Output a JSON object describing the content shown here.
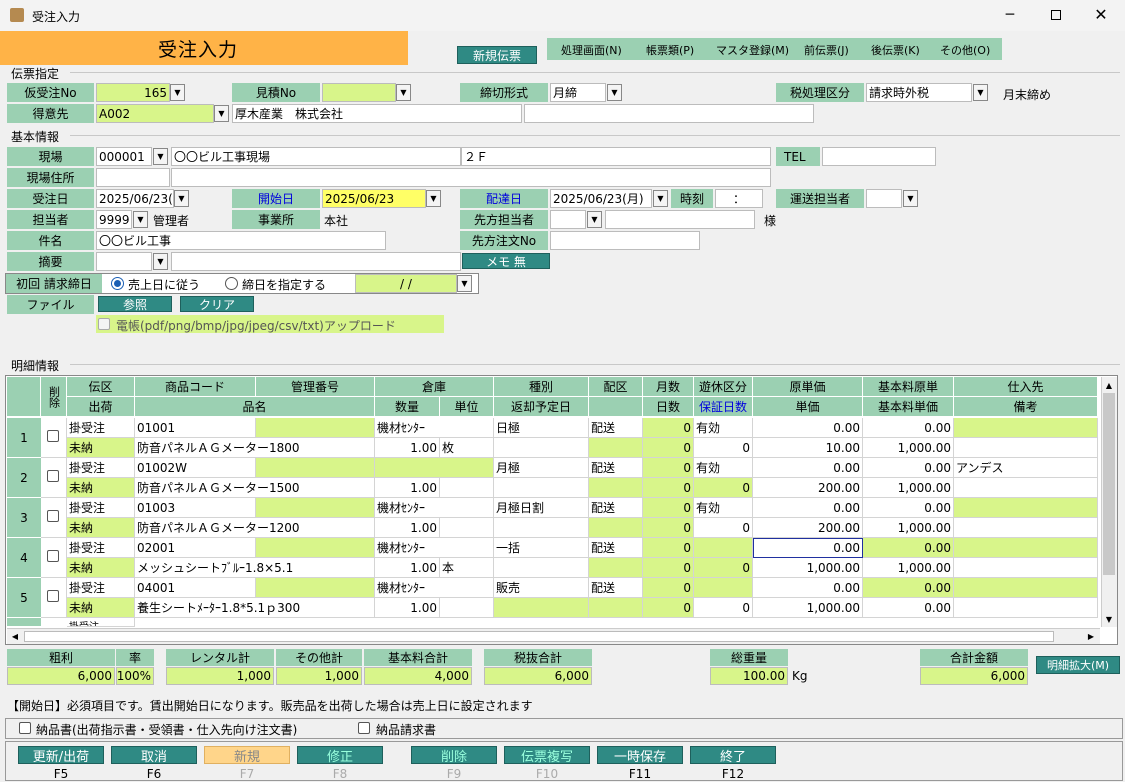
{
  "window": {
    "title": "受注入力"
  },
  "header": {
    "title": "受注入力",
    "new_button": "新規伝票",
    "menu": [
      "処理画面(N)",
      "帳票類(P)",
      "マスタ登録(M)",
      "前伝票(J)",
      "後伝票(K)",
      "その他(O)"
    ]
  },
  "denpyo": {
    "section": "伝票指定",
    "kari_label": "仮受注No",
    "kari_value": "165",
    "mitsumori_label": "見積No",
    "mitsumori_value": "",
    "shime_label": "締切形式",
    "shime_value": "月締",
    "zei_label": "税処理区分",
    "zei_value": "請求時外税",
    "gatsumatsu": "月末締め",
    "tokui_label": "得意先",
    "tokui_code": "A002",
    "tokui_name": "厚木産業　株式会社"
  },
  "kihon": {
    "section": "基本情報",
    "genba_label": "現場",
    "genba_code": "000001",
    "genba_name": "〇〇ビル工事現場",
    "genba_floor": "２Ｆ",
    "tel_label": "TEL",
    "tel_value": "",
    "jusho_label": "現場住所",
    "juchu_label": "受注日",
    "juchu_value": "2025/06/23(",
    "kaishi_label": "開始日",
    "kaishi_value": "2025/06/23",
    "haitatsu_label": "配達日",
    "haitatsu_value": "2025/06/23(月)",
    "jikoku_label": "時刻",
    "jikoku_value": "：",
    "unso_label": "運送担当者",
    "tanto_label": "担当者",
    "tanto_code": "9999",
    "tanto_name": "管理者",
    "jigyo_label": "事業所",
    "jigyo_value": "本社",
    "senpo_label": "先方担当者",
    "sama": "様",
    "kenmei_label": "件名",
    "kenmei_value": "〇〇ビル工事",
    "chumon_label": "先方注文No",
    "tekiyo_label": "摘要",
    "memo_button": "メモ 無",
    "seikyu_label": "初回 請求締日",
    "radio1": "売上日に従う",
    "radio2": "締日を指定する",
    "seikyu_date": "  /  /",
    "file_label": "ファイル",
    "sansho_button": "参照",
    "clear_button": "クリア",
    "upload_label": "電帳(pdf/png/bmp/jpg/jpeg/csv/txt)アップロード"
  },
  "meisai": {
    "section": "明細情報",
    "headers_top": [
      "削除",
      "伝区",
      "商品コード",
      "管理番号",
      "倉庫",
      "種別",
      "配区",
      "月数",
      "遊休区分",
      "原単価",
      "基本料原単",
      "仕入先"
    ],
    "headers_bottom": [
      "出荷",
      "品名",
      "数量",
      "単位",
      "返却予定日",
      "日数",
      "保証日数",
      "単価",
      "基本料単価",
      "備考"
    ],
    "rows": [
      {
        "no": "1",
        "denku": "掛受注",
        "code": "01001",
        "kanri": "",
        "soko": "機材ｾﾝﾀｰ",
        "shubetsu": "日極",
        "haiku": "配送",
        "tsukisu": "0",
        "yukyu": "有効",
        "gen": "0.00",
        "kihon_gen": "0.00",
        "shiire": "",
        "shukka": "未納",
        "hinmei": "防音パネルＡＧメーター1800",
        "suryo": "1.00",
        "tani": "枚",
        "henkyaku": "",
        "nissu": "0",
        "hosho": "0",
        "tanka": "10.00",
        "kihon_tanka": "1,000.00",
        "biko": ""
      },
      {
        "no": "2",
        "denku": "掛受注",
        "code": "01002W",
        "kanri": "",
        "soko": "",
        "shubetsu": "月極",
        "haiku": "配送",
        "tsukisu": "0",
        "yukyu": "有効",
        "gen": "0.00",
        "kihon_gen": "0.00",
        "shiire": "アンデス",
        "shukka": "未納",
        "hinmei": "防音パネルＡＧメーター1500",
        "suryo": "1.00",
        "tani": "",
        "henkyaku": "",
        "nissu": "0",
        "hosho": "0",
        "tanka": "200.00",
        "kihon_tanka": "1,000.00",
        "biko": ""
      },
      {
        "no": "3",
        "denku": "掛受注",
        "code": "01003",
        "kanri": "",
        "soko": "機材ｾﾝﾀｰ",
        "shubetsu": "月極日割",
        "haiku": "配送",
        "tsukisu": "0",
        "yukyu": "有効",
        "gen": "0.00",
        "kihon_gen": "0.00",
        "shiire": "",
        "shukka": "未納",
        "hinmei": "防音パネルＡＧメーター1200",
        "suryo": "1.00",
        "tani": "",
        "henkyaku": "",
        "nissu": "0",
        "hosho": "0",
        "tanka": "200.00",
        "kihon_tanka": "1,000.00",
        "biko": ""
      },
      {
        "no": "4",
        "denku": "掛受注",
        "code": "02001",
        "kanri": "",
        "soko": "機材ｾﾝﾀｰ",
        "shubetsu": "一括",
        "haiku": "配送",
        "tsukisu": "0",
        "yukyu": "",
        "gen": "0.00",
        "kihon_gen": "0.00",
        "shiire": "",
        "shukka": "未納",
        "hinmei": "メッシュシートﾌﾞﾙｰ1.8×5.1",
        "suryo": "1.00",
        "tani": "本",
        "henkyaku": "",
        "nissu": "0",
        "hosho": "0",
        "tanka": "1,000.00",
        "kihon_tanka": "1,000.00",
        "biko": ""
      },
      {
        "no": "5",
        "denku": "掛受注",
        "code": "04001",
        "kanri": "",
        "soko": "機材ｾﾝﾀｰ",
        "shubetsu": "販売",
        "haiku": "配送",
        "tsukisu": "0",
        "yukyu": "",
        "gen": "0.00",
        "kihon_gen": "0.00",
        "shiire": "",
        "shukka": "未納",
        "hinmei": "養生シートﾒｰﾀｰ1.8*5.1ｐ300",
        "suryo": "1.00",
        "tani": "",
        "henkyaku": "",
        "nissu": "0",
        "hosho": "0",
        "tanka": "1,000.00",
        "kihon_tanka": "0.00",
        "biko": ""
      }
    ],
    "partial_row": "掛受注"
  },
  "totals": {
    "arari_label": "粗利",
    "arari": "6,000",
    "ritsu_label": "率",
    "ritsu": "100%",
    "rental_label": "レンタル計",
    "rental": "1,000",
    "sonota_label": "その他計",
    "sonota": "1,000",
    "kihon_label": "基本料合計",
    "kihon": "4,000",
    "zeinuki_label": "税抜合計",
    "zeinuki": "6,000",
    "juryo_label": "総重量",
    "juryo": "100.00",
    "kg": "Kg",
    "gokei_label": "合計金額",
    "gokei": "6,000",
    "expand_button": "明細拡大(M)"
  },
  "status": {
    "message": "【開始日】必須項目です。賃出開始日になります。販売品を出荷した場合は売上日に設定されます",
    "chk1": "納品書(出荷指示書・受領書・仕入先向け注文書)",
    "chk2": "納品請求書"
  },
  "footer": {
    "buttons": [
      {
        "label": "更新/出荷",
        "key": "F5"
      },
      {
        "label": "取消",
        "key": "F6"
      },
      {
        "label": "新規",
        "key": "F7"
      },
      {
        "label": "修正",
        "key": "F8"
      },
      {
        "label": "削除",
        "key": "F9"
      },
      {
        "label": "伝票複写",
        "key": "F10"
      },
      {
        "label": "一時保存",
        "key": "F11"
      },
      {
        "label": "終了",
        "key": "F12"
      }
    ]
  }
}
